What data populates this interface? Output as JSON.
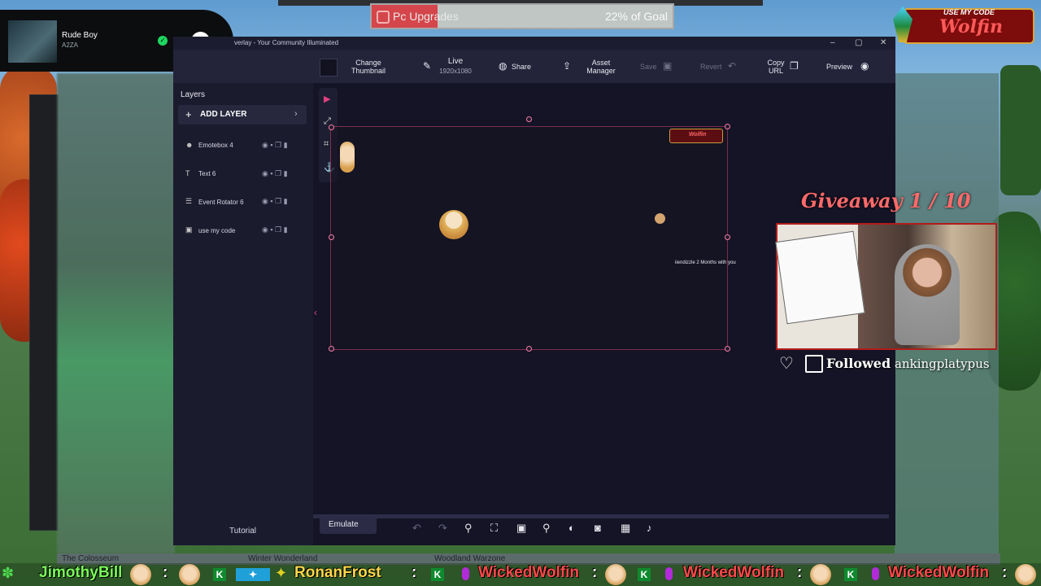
{
  "media_player": {
    "track": "Rude Boy",
    "artist": "A2ZA"
  },
  "goal": {
    "title": "Pc Upgrades",
    "progress_label": "22% of Goal",
    "progress": 0.22,
    "color": "#d4464b"
  },
  "code_banner": {
    "top": "USE MY CODE",
    "name": "Wolfin"
  },
  "window": {
    "title": "verlay - Your Community Illuminated"
  },
  "toolbar": {
    "change_thumbnail": "Change Thumbnail",
    "live": "Live",
    "resolution": "1920x1080",
    "share": "Share",
    "asset_manager": "Asset Manager",
    "save": "Save",
    "revert": "Revert",
    "copy_url": "Copy URL",
    "preview": "Preview"
  },
  "sidebar": {
    "heading": "Layers",
    "add_layer": "ADD LAYER",
    "layers": [
      {
        "name": "Emotebox 4",
        "icon": "emote-icon"
      },
      {
        "name": "Text 6",
        "icon": "text-icon"
      },
      {
        "name": "Event Rotator 6",
        "icon": "list-icon"
      },
      {
        "name": "use my code",
        "icon": "image-icon"
      }
    ],
    "tutorial": "Tutorial"
  },
  "canvas": {
    "mini_code": "Wolfin",
    "mini_sub": "iiendizzle 2 Months with you"
  },
  "bottom": {
    "emulate": "Emulate"
  },
  "giveaway": {
    "title": "Giveaway 1 / 10",
    "follow_label": "Followed",
    "follow_user": "ankingplatypus"
  },
  "scene_tabs": [
    "The Colosseum",
    "Winter Wonderland",
    "Woodland Warzone"
  ],
  "ticker": {
    "user1": "JimothyBill",
    "sep": ":",
    "user2": "RonanFrost",
    "user3": "WickedWolfin"
  },
  "colors": {
    "accent": "#e0407f",
    "window_bg": "#141426",
    "toolbar_bg": "#23233a"
  }
}
